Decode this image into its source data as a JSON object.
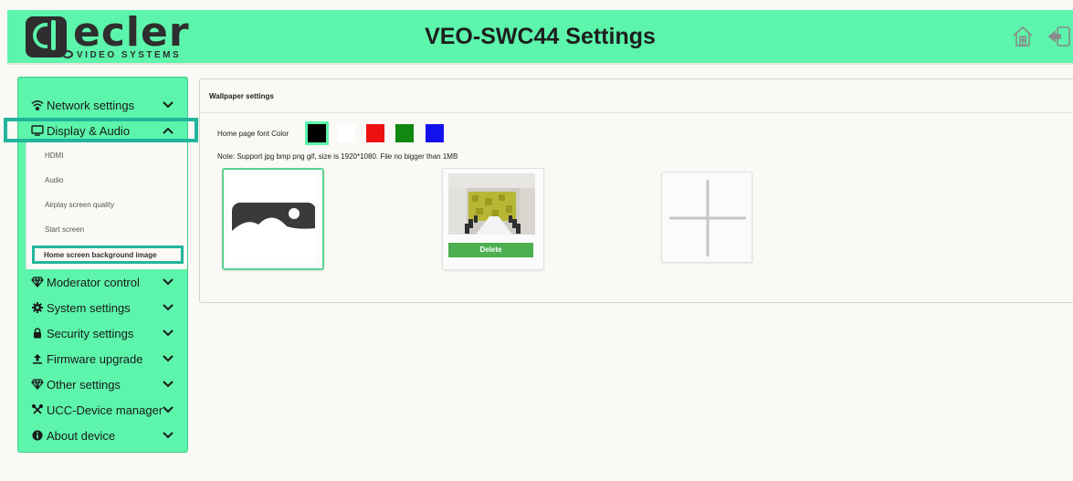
{
  "header": {
    "logo_text": "ecler",
    "logo_sub": "VIDEO SYSTEMS",
    "title": "VEO-SWC44 Settings",
    "icons": [
      "home-icon",
      "logout-icon"
    ]
  },
  "sidebar": {
    "items": [
      {
        "label": "Network settings",
        "icon": "wifi-icon",
        "expanded": false
      },
      {
        "label": "Display & Audio",
        "icon": "monitor-icon",
        "expanded": true
      },
      {
        "label": "Moderator control",
        "icon": "diamond-icon",
        "expanded": false
      },
      {
        "label": "System settings",
        "icon": "gear-icon",
        "expanded": false
      },
      {
        "label": "Security settings",
        "icon": "lock-icon",
        "expanded": false
      },
      {
        "label": "Firmware upgrade",
        "icon": "upload-icon",
        "expanded": false
      },
      {
        "label": "Other settings",
        "icon": "diamond-icon",
        "expanded": false
      },
      {
        "label": "UCC-Device manager",
        "icon": "tools-icon",
        "expanded": false
      },
      {
        "label": "About device",
        "icon": "info-icon",
        "expanded": false
      }
    ],
    "sub_items": [
      "HDMI",
      "Audio",
      "Airplay screen quality",
      "Start screen",
      "Home screen background image"
    ],
    "active_sub_item": "Home screen background image"
  },
  "main": {
    "section_title": "Wallpaper settings",
    "font_color_label": "Home page font Color",
    "font_colors": [
      "#000000",
      "#ffffff",
      "#ee1111",
      "#118811",
      "#1111ee"
    ],
    "selected_font_color": "#000000",
    "note": "Note: Support jpg bmp png gif, size is 1920*1080. File no bigger than 1MB",
    "wallpapers": [
      {
        "type": "default-image",
        "selected": true
      },
      {
        "type": "conference-room-photo",
        "selected": false,
        "delete_label": "Delete"
      }
    ],
    "add_icon": "plus-icon"
  },
  "colors": {
    "accent_green": "#5cf5ab",
    "highlight_teal": "#22b59c",
    "delete_green": "#4caf50",
    "background": "#fbf9f5"
  }
}
